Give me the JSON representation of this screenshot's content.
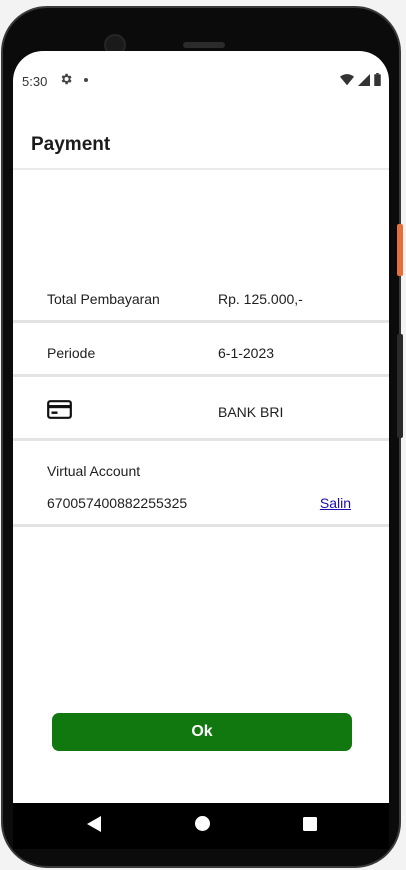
{
  "status_bar": {
    "time": "5:30",
    "icons": [
      "gear-icon",
      "dot-icon",
      "wifi-icon",
      "signal-icon",
      "battery-icon"
    ]
  },
  "app_bar": {
    "title": "Payment"
  },
  "payment": {
    "total_label": "Total Pembayaran",
    "total_value": "Rp. 125.000,-",
    "period_label": "Periode",
    "period_value": "6-1-2023",
    "method_icon": "credit-card-icon",
    "method_value": "BANK BRI",
    "va_label": "Virtual Account",
    "va_number": "670057400882255325",
    "copy_label": "Salin"
  },
  "actions": {
    "ok_label": "Ok"
  },
  "nav_bar": {
    "icons": [
      "back-icon",
      "home-icon",
      "recents-icon"
    ]
  },
  "colors": {
    "primary_button": "#11770f",
    "link": "#1a0dab",
    "divider": "#e3e3e3"
  }
}
